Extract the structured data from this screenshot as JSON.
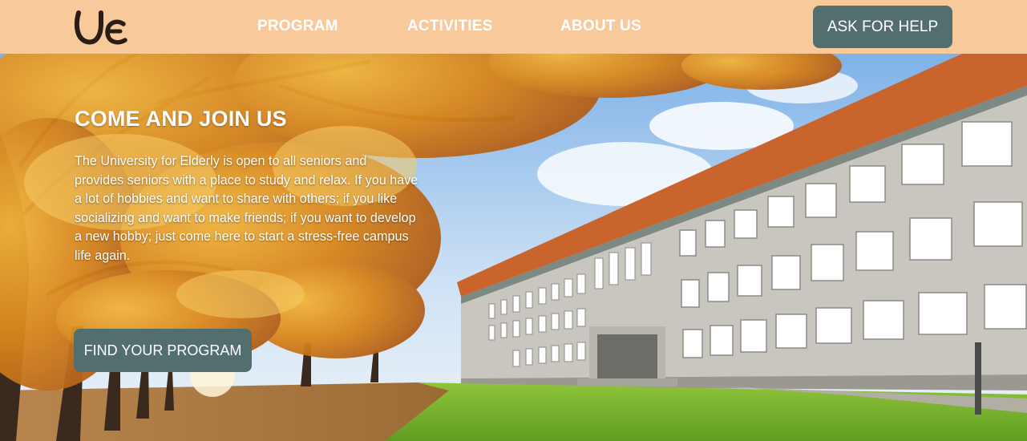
{
  "header": {
    "logo_alt": "UE logo",
    "nav": [
      {
        "label": "PROGRAM"
      },
      {
        "label": "ACTIVITIES"
      },
      {
        "label": "ABOUT US"
      }
    ],
    "help_button": "ASK FOR HELP"
  },
  "hero": {
    "title": "COME AND JOIN US",
    "description": "The University for Elderly is open to all seniors and provides seniors with a place to study and relax. If you have a lot of hobbies and want to share with others; if you like socializing and want to make friends; if you want to develop a new hobby; just come here to start a stress-free campus life again.",
    "cta_button": "FIND YOUR PROGRAM",
    "background_image": "autumn-campus-photo"
  },
  "colors": {
    "header_bg": "#f8c99a",
    "button_bg": "#536e6f",
    "button_text": "#ffffff",
    "logo": "#2a1d17"
  }
}
